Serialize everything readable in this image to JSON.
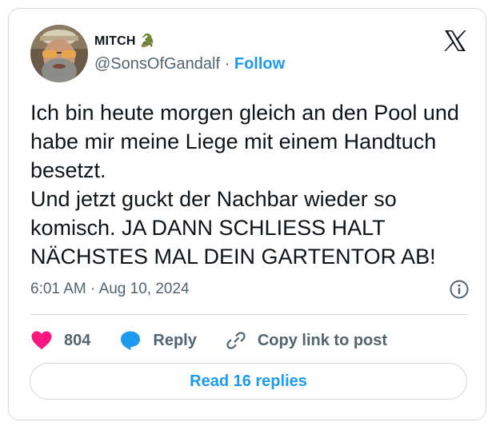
{
  "author": {
    "display_name": "MITCH",
    "name_glyph": "🐊",
    "handle": "@SonsOfGandalf",
    "separator": "·",
    "follow_label": "Follow"
  },
  "post": {
    "text": "Ich bin heute morgen gleich an den Pool und habe mir meine Liege mit einem Handtuch besetzt.\nUnd jetzt guckt der Nachbar wieder so komisch. JA DANN SCHLIESS HALT NÄCHSTES MAL DEIN GARTENTOR AB!",
    "time": "6:01 AM",
    "separator": "·",
    "date": "Aug 10, 2024"
  },
  "actions": {
    "like_count": "804",
    "reply_label": "Reply",
    "copy_link_label": "Copy link to post"
  },
  "read_replies_label": "Read 16 replies",
  "icons": {
    "brand": "x-logo-icon",
    "info": "info-icon",
    "like": "heart-icon",
    "reply": "speech-bubble-icon",
    "copy": "link-icon"
  },
  "colors": {
    "accent": "#1d9bf0",
    "like": "#f91880",
    "secondary_text": "#536471",
    "border": "#cfd9de"
  }
}
